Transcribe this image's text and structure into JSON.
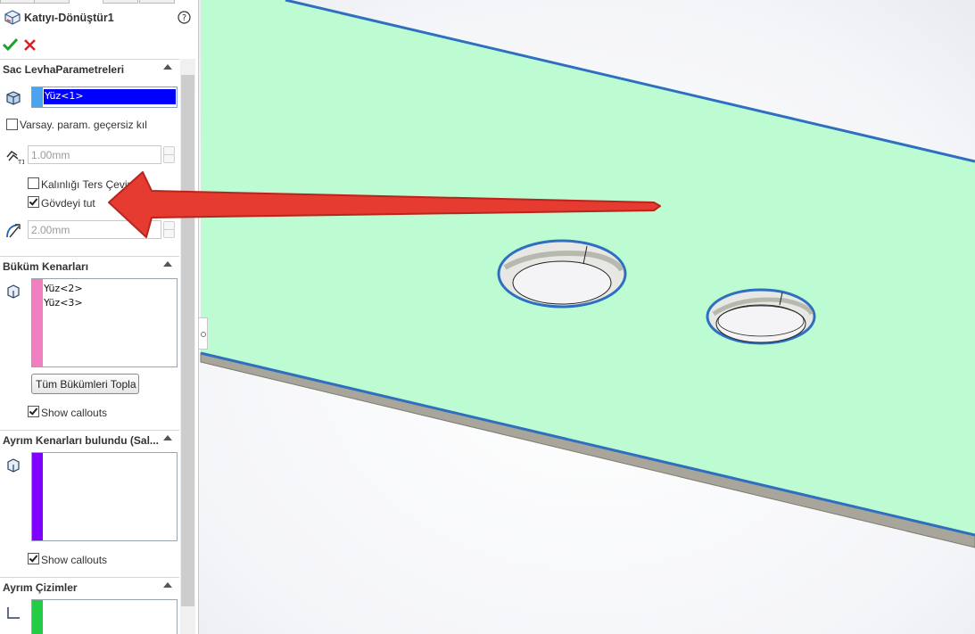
{
  "panel": {
    "title": "Katıyı-Dönüştür1",
    "help_icon": "help-icon",
    "ok_icon": "green-check-icon",
    "cancel_icon": "red-x-icon",
    "sections": {
      "sheet_params": {
        "header": "Sac LevhaParametreleri",
        "selected_face": "Yüz<1>",
        "override_label": "Varsay. param. geçersiz kıl",
        "override_checked": false,
        "thickness_value": "1.00mm",
        "reverse_thickness_label": "Kalınlığı Ters Çevir",
        "reverse_thickness_checked": false,
        "keep_body_label": "Gövdeyi tut",
        "keep_body_checked": true,
        "radius_value": "2.00mm"
      },
      "bend_edges": {
        "header": "Büküm Kenarları",
        "items": [
          "Yüz<2>",
          "Yüz<3>"
        ],
        "collect_button": "Tüm Bükümleri Topla",
        "show_callouts_label": "Show callouts",
        "show_callouts_checked": true
      },
      "rip_edges": {
        "header": "Ayrım Kenarları bulundu (Sal...",
        "items": [],
        "show_callouts_label": "Show callouts",
        "show_callouts_checked": true
      },
      "rip_sketches": {
        "header": "Ayrım Çizimler",
        "items": []
      }
    }
  },
  "colors": {
    "face1_selection": "#0000ff",
    "face1_strip": "#4aa3f0",
    "bend_strip": "#f07fc0",
    "rip_strip": "#8000ff",
    "sketch_strip": "#22cc44",
    "sheet_face": "#bdfcd2",
    "sheet_edge": "#2e6fbf",
    "annotation_arrow": "#e63b30"
  }
}
